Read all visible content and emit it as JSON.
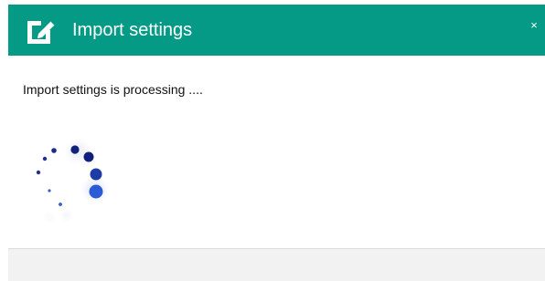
{
  "dialog": {
    "title": "Import settings",
    "close_label": "×",
    "message": "Import settings is processing ....",
    "icon": "edit-icon"
  },
  "colors": {
    "header": "#049a86",
    "spinner_dark": "#0a1a7a",
    "spinner_mid": "#2d56c8",
    "footer": "#f2f2f2"
  },
  "spinner": {
    "icon": "loading-spinner"
  }
}
